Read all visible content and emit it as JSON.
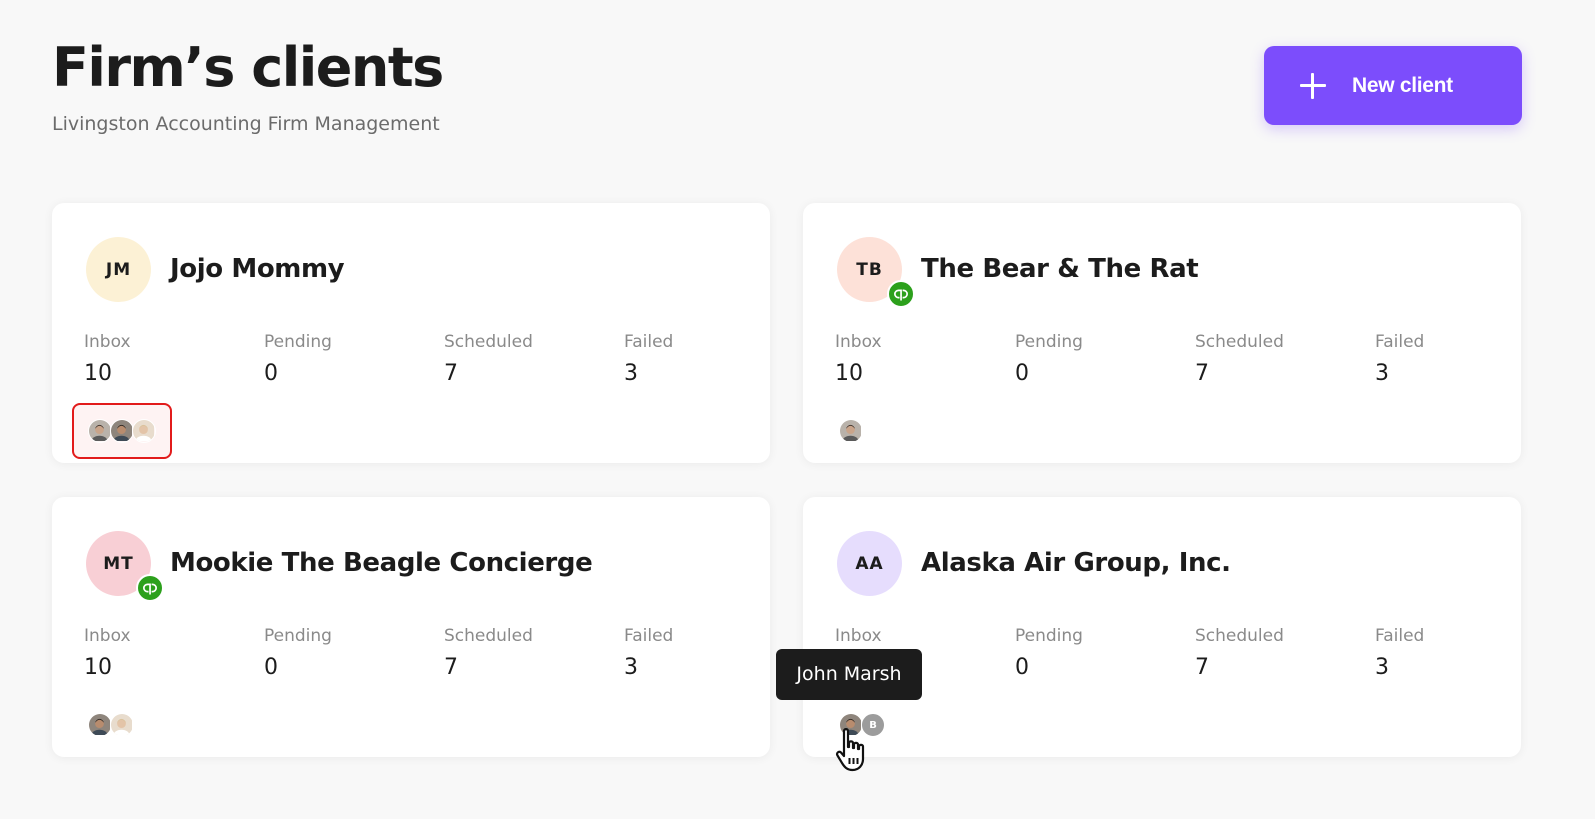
{
  "header": {
    "title": "Firm’s clients",
    "subtitle": "Livingston Accounting Firm Management",
    "new_client_label": "New client"
  },
  "stat_labels": [
    "Inbox",
    "Pending",
    "Scheduled",
    "Failed"
  ],
  "clients": [
    {
      "initials": "JM",
      "name": "Jojo Mommy",
      "avatar_color": "#fcf1d5",
      "quickbooks_connected": false,
      "stats": [
        "10",
        "0",
        "7",
        "3"
      ],
      "team": [
        "photo",
        "photo",
        "photo"
      ]
    },
    {
      "initials": "TB",
      "name": "The Bear & The Rat",
      "avatar_color": "#fde1d8",
      "quickbooks_connected": true,
      "stats": [
        "10",
        "0",
        "7",
        "3"
      ],
      "team": [
        "photo"
      ]
    },
    {
      "initials": "MT",
      "name": "Mookie The Beagle Concierge",
      "avatar_color": "#f8cfd5",
      "quickbooks_connected": true,
      "stats": [
        "10",
        "0",
        "7",
        "3"
      ],
      "team": [
        "photo",
        "photo"
      ]
    },
    {
      "initials": "AA",
      "name": "Alaska Air Group, Inc.",
      "avatar_color": "#e6ddfd",
      "quickbooks_connected": false,
      "stats": [
        "10",
        "0",
        "7",
        "3"
      ],
      "team": [
        "photo",
        "B"
      ]
    }
  ],
  "tooltip": "John Marsh",
  "icons": {
    "new_client": "plus-icon",
    "accounting_badge": "quickbooks-icon",
    "cursor": "hand-pointer-icon"
  },
  "colors": {
    "accent": "#7c4dfc",
    "quickbooks": "#2ca01c",
    "highlight": "#e21b1b"
  }
}
